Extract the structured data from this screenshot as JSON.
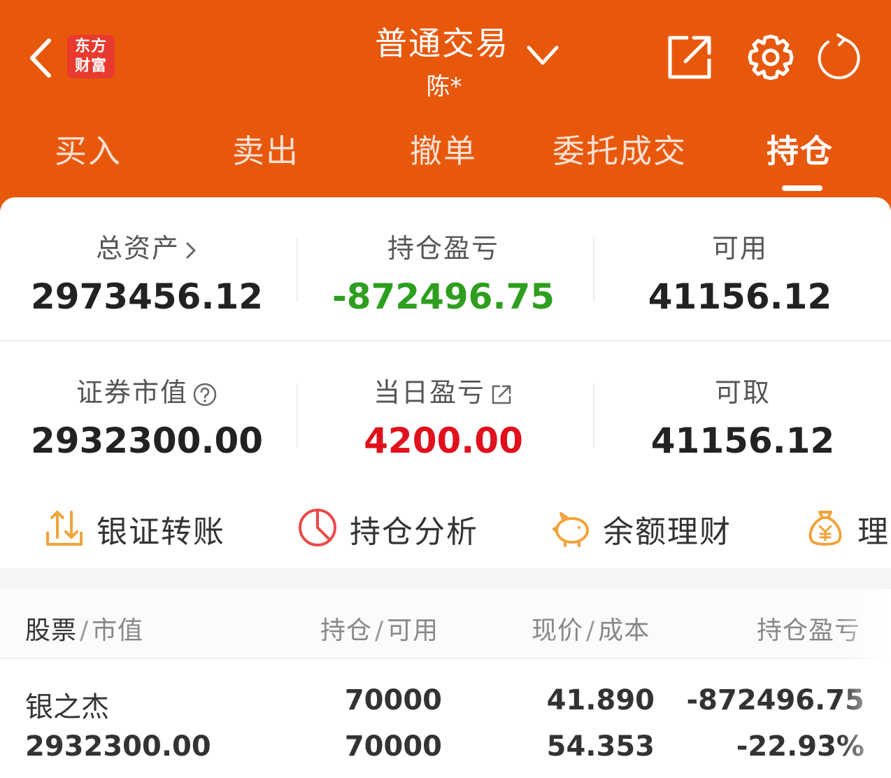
{
  "header": {
    "logo_line1": "东方",
    "logo_line2": "财富",
    "title": "普通交易",
    "subtitle": "陈*"
  },
  "tabs": [
    {
      "label": "买入"
    },
    {
      "label": "卖出"
    },
    {
      "label": "撤单"
    },
    {
      "label": "委托成交"
    },
    {
      "label": "持仓",
      "active": true
    }
  ],
  "stats": {
    "total_assets_label": "总资产",
    "total_assets_value": "2973456.12",
    "position_pnl_label": "持仓盈亏",
    "position_pnl_value": "-872496.75",
    "available_label": "可用",
    "available_value": "41156.12",
    "market_value_label": "证券市值",
    "market_value_value": "2932300.00",
    "daily_pnl_label": "当日盈亏",
    "daily_pnl_value": "4200.00",
    "withdrawable_label": "可取",
    "withdrawable_value": "41156.12"
  },
  "quick_actions": [
    {
      "label": "银证转账",
      "icon": "transfer-icon"
    },
    {
      "label": "持仓分析",
      "icon": "pie-chart-icon"
    },
    {
      "label": "余额理财",
      "icon": "piggy-bank-icon"
    },
    {
      "label": "理财",
      "icon": "money-bag-icon"
    }
  ],
  "table": {
    "col1_a": "股票",
    "col1_b": "市值",
    "col2_a": "持仓",
    "col2_b": "可用",
    "col3_a": "现价",
    "col3_b": "成本",
    "col4": "持仓盈亏",
    "sep": "/",
    "rows": [
      {
        "name": "银之杰",
        "market_value": "2932300.00",
        "position": "70000",
        "available": "70000",
        "price": "41.890",
        "cost": "54.353",
        "pnl": "-872496.75",
        "pnl_pct": "-22.93%"
      }
    ]
  },
  "colors": {
    "brand": "#e8580c",
    "logo_red": "#e83a2e",
    "loss_green": "#2e9e1f",
    "gain_red": "#e0101c",
    "accent_orange": "#f2a33a",
    "accent_red": "#e84a4a"
  }
}
